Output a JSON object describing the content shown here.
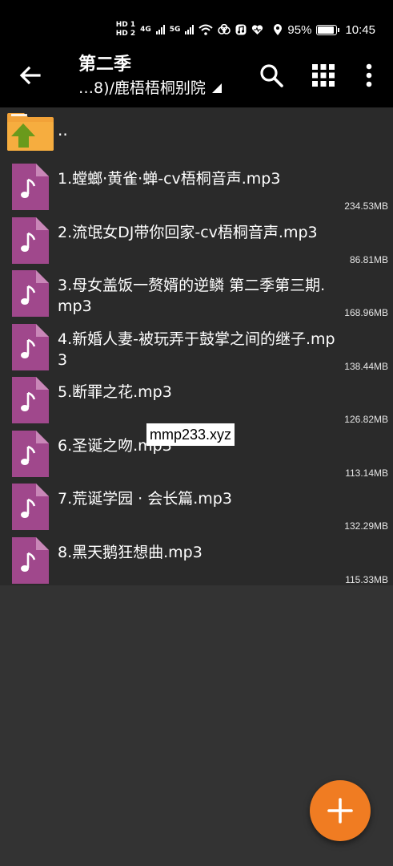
{
  "status_bar": {
    "hd1": "HD 1",
    "hd2": "HD 2",
    "net1": "4G",
    "net2": "5G",
    "battery_percent": "95%",
    "battery_level": 0.95,
    "time": "10:45",
    "icons": [
      "signal-icon",
      "wifi-icon",
      "cloud-icon",
      "music-app-icon",
      "heart-icon",
      "location-icon",
      "battery-icon"
    ]
  },
  "toolbar": {
    "title": "第二季",
    "path": "…8)/鹿梧梧桐别院",
    "icons": [
      "back-arrow-icon",
      "search-icon",
      "grid-view-icon",
      "more-vert-icon"
    ]
  },
  "parent_folder": {
    "label": ".."
  },
  "files": [
    {
      "name": "1.螳螂·黄雀·蝉-cv梧桐音声.mp3",
      "size": "234.53MB"
    },
    {
      "name": "2.流氓女DJ带你回家-cv梧桐音声.mp3",
      "size": "86.81MB"
    },
    {
      "name": "3.母女盖饭一赘婿的逆鳞 第二季第三期.mp3",
      "size": "168.96MB"
    },
    {
      "name": "4.新婚人妻-被玩弄于鼓掌之间的继子.mp3",
      "size": "138.44MB"
    },
    {
      "name": "5.断罪之花.mp3",
      "size": "126.82MB"
    },
    {
      "name": "6.圣诞之吻.mp3",
      "size": "113.14MB"
    },
    {
      "name": "7.荒诞学园 · 会长篇.mp3",
      "size": "132.29MB"
    },
    {
      "name": "8.黑天鹅狂想曲.mp3",
      "size": "115.33MB"
    }
  ],
  "watermark": "mmp233.xyz",
  "fab": {
    "icon": "plus-icon"
  },
  "colors": {
    "background": "#333333",
    "list_background": "#2a2a2a",
    "bar": "#000000",
    "file_icon": "#a0488c",
    "folder": "#f2a238",
    "folder_arrow": "#6a9a1c",
    "fab": "#f07c22"
  }
}
